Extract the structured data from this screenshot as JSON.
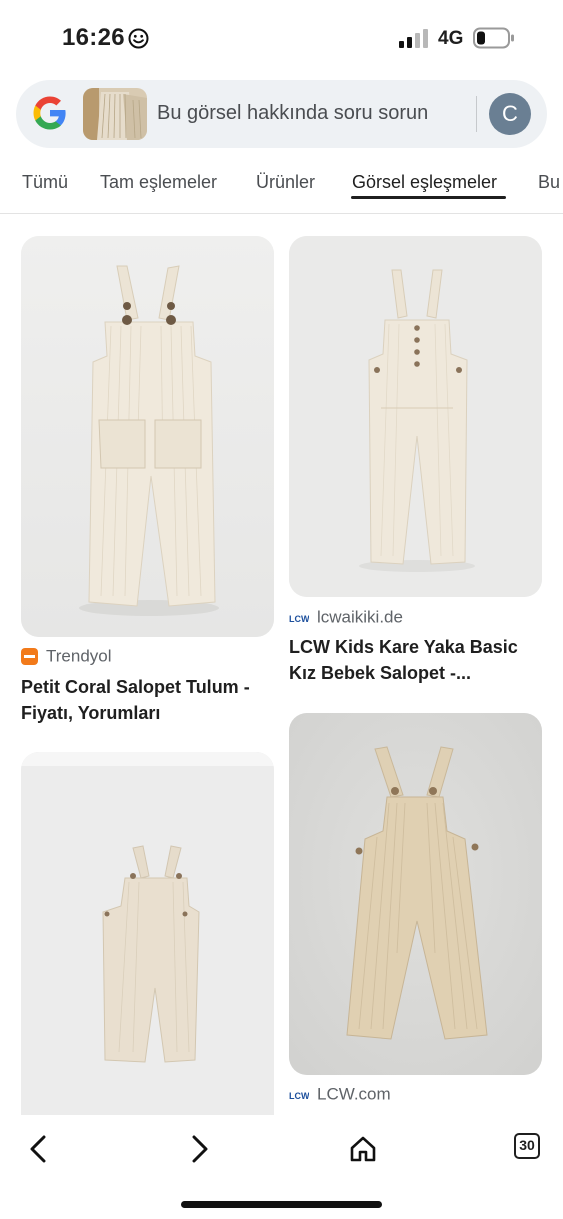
{
  "status_bar": {
    "time": "16:26",
    "network": "4G",
    "icons": [
      "smiley-icon",
      "signal-icon",
      "battery-icon"
    ]
  },
  "search": {
    "placeholder": "Bu görsel hakkında soru sorun",
    "avatar_letter": "C",
    "icons": [
      "google-logo-icon"
    ]
  },
  "tabs": [
    {
      "label": "Tümü",
      "active": false
    },
    {
      "label": "Tam eşlemeler",
      "active": false
    },
    {
      "label": "Ürünler",
      "active": false
    },
    {
      "label": "Görsel eşleşmeler",
      "active": true
    },
    {
      "label": "Bu",
      "active": false
    }
  ],
  "results": [
    {
      "source": "Trendyol",
      "title_line1": "Petit Coral Salopet Tulum -",
      "title_line2": "Fiyatı, Yorumları",
      "favicon": "trendyol-favicon"
    },
    {
      "source": "lcwaikiki.de",
      "title_line1": "LCW Kids Kare Yaka Basic",
      "title_line2": "Kız Bebek Salopet -...",
      "favicon": "lcw-favicon"
    },
    {
      "source": "LCW.com",
      "title_line1": "",
      "title_line2": "",
      "favicon": "lcw-favicon"
    },
    {
      "source": "",
      "title_line1": "",
      "title_line2": "",
      "favicon": ""
    }
  ],
  "toolbar": {
    "tab_count": "30",
    "icons": [
      "back-arrow-icon",
      "forward-arrow-icon",
      "home-icon",
      "tabs-icon"
    ]
  },
  "colors": {
    "accent": "#1f1f1f",
    "search_bg": "#eef1f4",
    "avatar": "#6a7f93",
    "card_bg": "#ebecec",
    "overall_fabric": "#e8ddc9",
    "lcw_blue": "#1c4f9c",
    "trendyol_orange": "#f27a1a"
  }
}
